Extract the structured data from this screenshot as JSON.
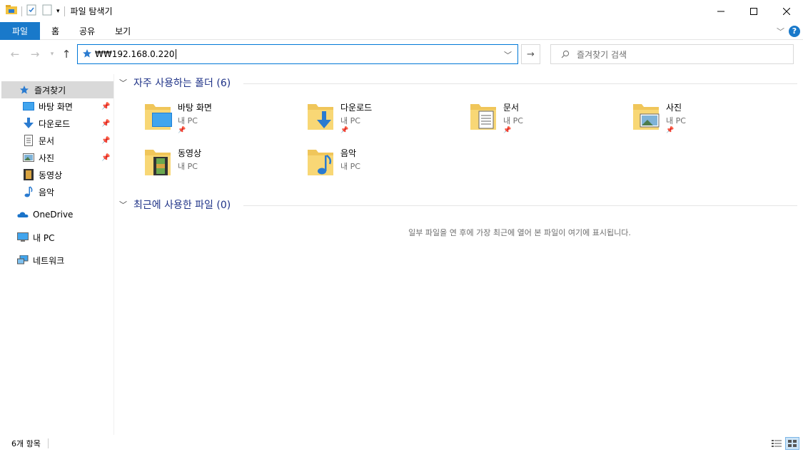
{
  "window": {
    "title": "파일 탐색기",
    "controls": [
      "minimize",
      "maximize",
      "close"
    ]
  },
  "ribbon": {
    "tabs": [
      "파일",
      "홈",
      "공유",
      "보기"
    ]
  },
  "address": {
    "value": "₩₩192.168.0.220",
    "search_placeholder": "즐겨찾기 검색"
  },
  "sidebar": {
    "quick_access": "즐겨찾기",
    "pinned": [
      {
        "label": "바탕 화면",
        "icon": "desktop-icon"
      },
      {
        "label": "다운로드",
        "icon": "download-icon"
      },
      {
        "label": "문서",
        "icon": "documents-icon"
      },
      {
        "label": "사진",
        "icon": "pictures-icon"
      }
    ],
    "unpinned": [
      {
        "label": "동영상",
        "icon": "videos-icon"
      },
      {
        "label": "음악",
        "icon": "music-icon"
      }
    ],
    "onedrive": "OneDrive",
    "this_pc": "내 PC",
    "network": "네트워크"
  },
  "main": {
    "frequent_header": "자주 사용하는 폴더 (6)",
    "folders": [
      {
        "name": "바탕 화면",
        "location": "내 PC",
        "pinned": true,
        "icon": "desktop-folder-icon"
      },
      {
        "name": "다운로드",
        "location": "내 PC",
        "pinned": true,
        "icon": "download-folder-icon"
      },
      {
        "name": "문서",
        "location": "내 PC",
        "pinned": true,
        "icon": "documents-folder-icon"
      },
      {
        "name": "사진",
        "location": "내 PC",
        "pinned": true,
        "icon": "pictures-folder-icon"
      },
      {
        "name": "동영상",
        "location": "내 PC",
        "pinned": false,
        "icon": "videos-folder-icon"
      },
      {
        "name": "음악",
        "location": "내 PC",
        "pinned": false,
        "icon": "music-folder-icon"
      }
    ],
    "recent_header": "최근에 사용한 파일 (0)",
    "recent_empty": "일부 파일을 연 후에 가장 최근에 열어 본 파일이 여기에 표시됩니다."
  },
  "status": {
    "count": "6개 항목"
  },
  "colors": {
    "accent": "#1979ca",
    "header_text": "#1e3287",
    "selected_bg": "#d9d9d9"
  }
}
